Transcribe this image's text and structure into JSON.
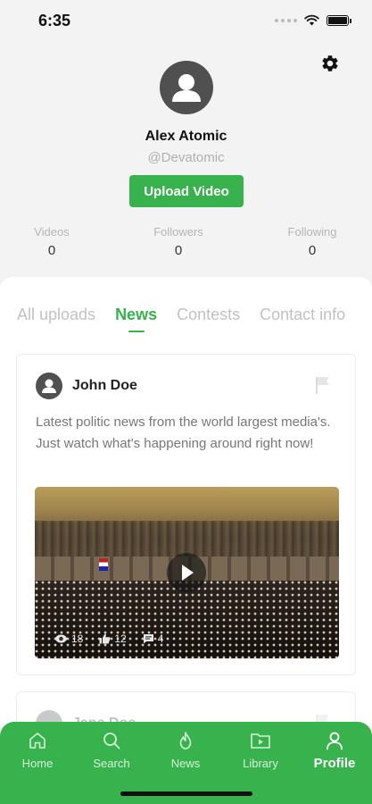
{
  "status_bar": {
    "time": "6:35"
  },
  "profile": {
    "name": "Alex Atomic",
    "handle": "@Devatomic",
    "upload_label": "Upload Video",
    "stats": [
      {
        "label": "Videos",
        "value": "0"
      },
      {
        "label": "Followers",
        "value": "0"
      },
      {
        "label": "Following",
        "value": "0"
      }
    ]
  },
  "tabs": [
    {
      "label": "All uploads",
      "active": false
    },
    {
      "label": "News",
      "active": true
    },
    {
      "label": "Contests",
      "active": false
    },
    {
      "label": "Contact info",
      "active": false
    }
  ],
  "posts": [
    {
      "author": "John Doe",
      "text": "Latest politic news from the world largest media's. Just watch what's happening around right now!",
      "views": "18",
      "likes": "12",
      "comments": "4"
    },
    {
      "author": "Jane Doe"
    }
  ],
  "bottom_nav": [
    {
      "label": "Home",
      "icon": "home-icon"
    },
    {
      "label": "Search",
      "icon": "search-icon"
    },
    {
      "label": "News",
      "icon": "flame-icon"
    },
    {
      "label": "Library",
      "icon": "folder-play-icon"
    },
    {
      "label": "Profile",
      "icon": "person-icon",
      "active": true
    }
  ],
  "colors": {
    "accent": "#37b24d",
    "muted": "#c2c2c2"
  }
}
